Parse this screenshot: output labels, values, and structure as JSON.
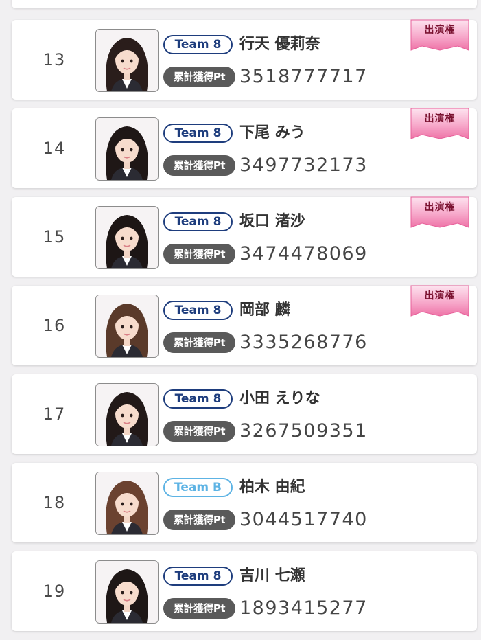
{
  "colors": {
    "page_background": "#f1f0f2",
    "card_background": "#ffffff",
    "team_8": "#1e3d7d",
    "team_b": "#5db3e4",
    "points_label_bg": "#5a5a5a",
    "ribbon_pink": "#f07fb0",
    "ribbon_text": "#7a1230"
  },
  "icons": {
    "photo": "member-photo-icon",
    "ribbon": "ribbon-badge-icon"
  },
  "ranking": [
    {
      "rank": "13",
      "team": "Team 8",
      "team_type": "team8",
      "name": "行天 優莉奈",
      "points_label": "累計獲得Pt",
      "points": "3518777717",
      "badge": "出演権",
      "hair": "#2a1d1b"
    },
    {
      "rank": "14",
      "team": "Team 8",
      "team_type": "team8",
      "name": "下尾 みう",
      "points_label": "累計獲得Pt",
      "points": "3497732173",
      "badge": "出演権",
      "hair": "#1f1716"
    },
    {
      "rank": "15",
      "team": "Team 8",
      "team_type": "team8",
      "name": "坂口 渚沙",
      "points_label": "累計獲得Pt",
      "points": "3474478069",
      "badge": "出演権",
      "hair": "#1d1615"
    },
    {
      "rank": "16",
      "team": "Team 8",
      "team_type": "team8",
      "name": "岡部 麟",
      "points_label": "累計獲得Pt",
      "points": "3335268776",
      "badge": "出演権",
      "hair": "#5a3a2a"
    },
    {
      "rank": "17",
      "team": "Team 8",
      "team_type": "team8",
      "name": "小田 えりな",
      "points_label": "累計獲得Pt",
      "points": "3267509351",
      "badge": "",
      "hair": "#221918"
    },
    {
      "rank": "18",
      "team": "Team B",
      "team_type": "teamb",
      "name": "柏木 由紀",
      "points_label": "累計獲得Pt",
      "points": "3044517740",
      "badge": "",
      "hair": "#6b4230"
    },
    {
      "rank": "19",
      "team": "Team 8",
      "team_type": "team8",
      "name": "吉川 七瀬",
      "points_label": "累計獲得Pt",
      "points": "1893415277",
      "badge": "",
      "hair": "#1e1716"
    }
  ]
}
